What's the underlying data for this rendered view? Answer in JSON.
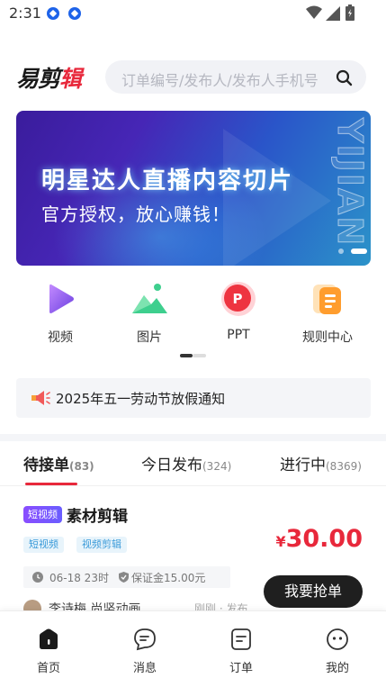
{
  "status_bar": {
    "time": "2:31"
  },
  "header": {
    "logo_part1": "易剪",
    "logo_part2": "辑",
    "search_placeholder": "订单编号/发布人/发布人手机号"
  },
  "banner": {
    "title": "明星达人直播内容切片",
    "subtitle": "官方授权，放心赚钱！",
    "vertical_text": "YIJIAN"
  },
  "categories": [
    {
      "label": "视频",
      "icon": "video-play-icon"
    },
    {
      "label": "图片",
      "icon": "image-mountain-icon"
    },
    {
      "label": "PPT",
      "icon": "ppt-icon"
    },
    {
      "label": "规则中心",
      "icon": "rules-document-icon"
    }
  ],
  "notice": {
    "text": "2025年五一劳动节放假通知"
  },
  "tabs": [
    {
      "label": "待接单",
      "count": "(83)",
      "active": true
    },
    {
      "label": "今日发布",
      "count": "(324)",
      "active": false
    },
    {
      "label": "进行中",
      "count": "(8369)",
      "active": false
    }
  ],
  "order": {
    "badge": "短视频",
    "title": "素材剪辑",
    "tags": [
      "短视频",
      "视频剪辑"
    ],
    "price_currency": "¥",
    "price_value": "30.00",
    "date": "06-18 23时",
    "deposit": "保证金15.00元",
    "grab_label": "我要抢单",
    "publisher": "李诗梅 尚竖动画",
    "publish_time": "刚刚 · 发布"
  },
  "bottom_nav": [
    {
      "label": "首页",
      "icon": "home-icon",
      "active": true
    },
    {
      "label": "消息",
      "icon": "message-icon",
      "active": false
    },
    {
      "label": "订单",
      "icon": "order-icon",
      "active": false
    },
    {
      "label": "我的",
      "icon": "profile-icon",
      "active": false
    }
  ],
  "colors": {
    "accent": "#e8283b",
    "dark": "#1f1f1f",
    "tag_blue": "#3a9ad9"
  }
}
